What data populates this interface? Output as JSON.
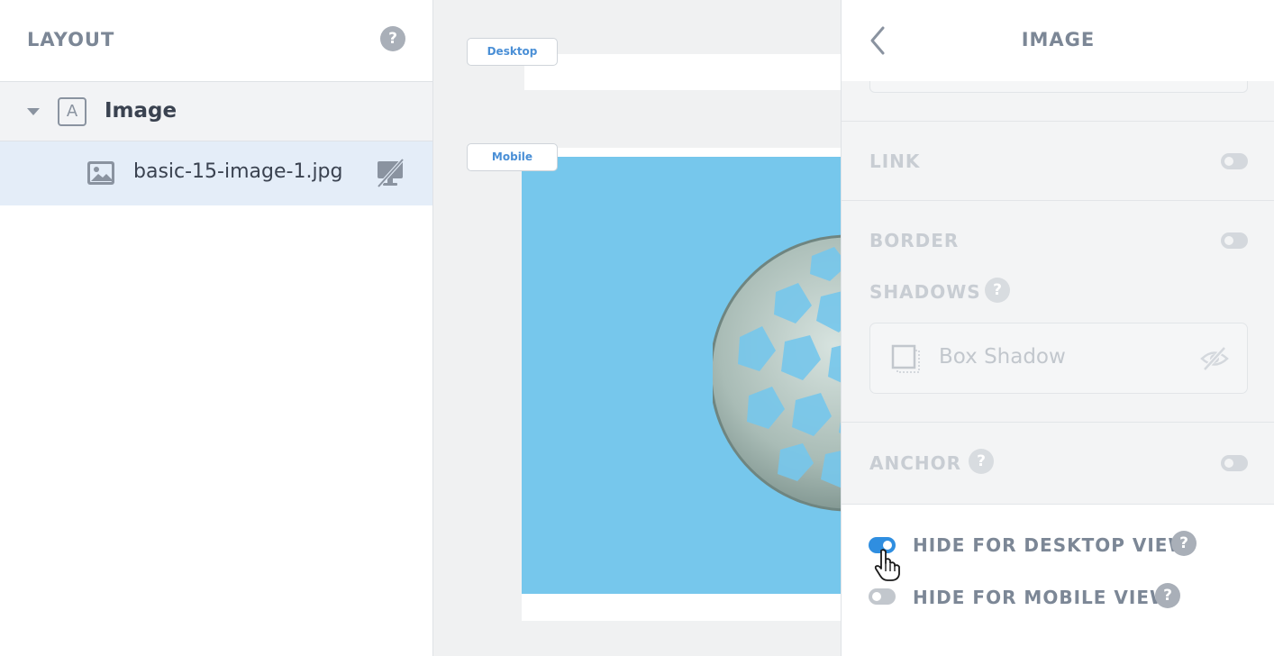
{
  "layout_panel": {
    "title": "LAYOUT",
    "help_glyph": "?",
    "tree": {
      "parent": {
        "label": "Image",
        "type_glyph": "A",
        "icon": "text-block-icon",
        "expanded": true
      },
      "child": {
        "label": "basic-15-image-1.jpg",
        "icon": "image-icon",
        "status_icon": "desktop-hidden-icon"
      }
    }
  },
  "canvas": {
    "desktop_tag": "Desktop",
    "mobile_tag": "Mobile",
    "image_background": "#76c7ec"
  },
  "settings_panel": {
    "title": "IMAGE",
    "back_icon": "chevron-left-icon",
    "sections": {
      "link": {
        "label": "LINK",
        "enabled": false
      },
      "border": {
        "label": "BORDER",
        "enabled": false
      },
      "shadows": {
        "label": "SHADOWS",
        "help_glyph": "?",
        "item": {
          "label": "Box Shadow",
          "visible": false
        }
      },
      "anchor": {
        "label": "ANCHOR",
        "help_glyph": "?",
        "enabled": false
      }
    },
    "visibility": {
      "hide_desktop": {
        "label": "HIDE FOR DESKTOP VIEW",
        "on": true,
        "help_glyph": "?"
      },
      "hide_mobile": {
        "label": "HIDE FOR MOBILE VIEW",
        "on": false,
        "help_glyph": "?"
      }
    }
  },
  "colors": {
    "accent": "#2f8ee0",
    "selected_row": "#e4edf8",
    "tag_text": "#4a8fd6"
  }
}
